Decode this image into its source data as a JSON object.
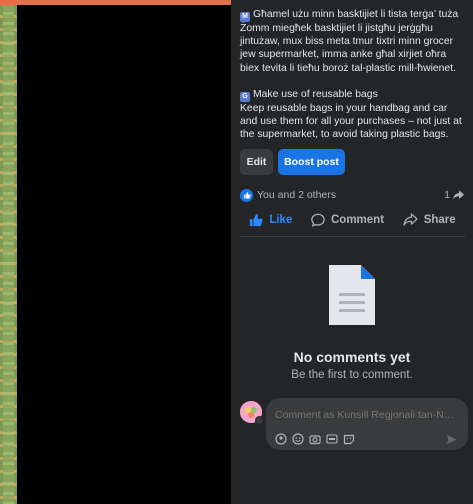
{
  "post": {
    "para_mt": {
      "tag": "M",
      "line1": "Għamel użu minn basktijiet li tista terġa’ tuża",
      "body": "Żomm miegħek basktijiet li jistgħu jerġgħu jintużaw, mux biss meta tmur tixtri minn grocer jew supermarket, imma anke għal xirjiet oħra biex tevita li tieħu boroż tal-plastic mill-ħwienet."
    },
    "para_en": {
      "tag": "G",
      "line1": "Make use of reusable bags",
      "body": "Keep reusable bags in your handbag and car and use them for all your purchases – not just at the supermarket, to avoid taking plastic bags."
    },
    "edit_label": "Edit",
    "boost_label": "Boost post"
  },
  "reactions": {
    "summary": "You and 2 others",
    "shares": "1"
  },
  "action_bar": {
    "like": "Like",
    "comment": "Comment",
    "share": "Share"
  },
  "comments": {
    "empty_title": "No comments yet",
    "empty_sub": "Be the first to comment."
  },
  "composer": {
    "placeholder": "Comment as Kunsill Reġjonali tan-Nof..."
  },
  "colors": {
    "accent": "#1b74e4",
    "like_blue": "#2d88ff",
    "panel": "#242526",
    "top_strip": "#e0724a"
  },
  "icons": [
    "thumbs-up-icon",
    "comment-bubble-icon",
    "share-arrow-icon",
    "document-icon",
    "avatar-icon",
    "emoji-icon",
    "camera-icon",
    "gif-icon",
    "sticker-icon",
    "send-icon"
  ]
}
